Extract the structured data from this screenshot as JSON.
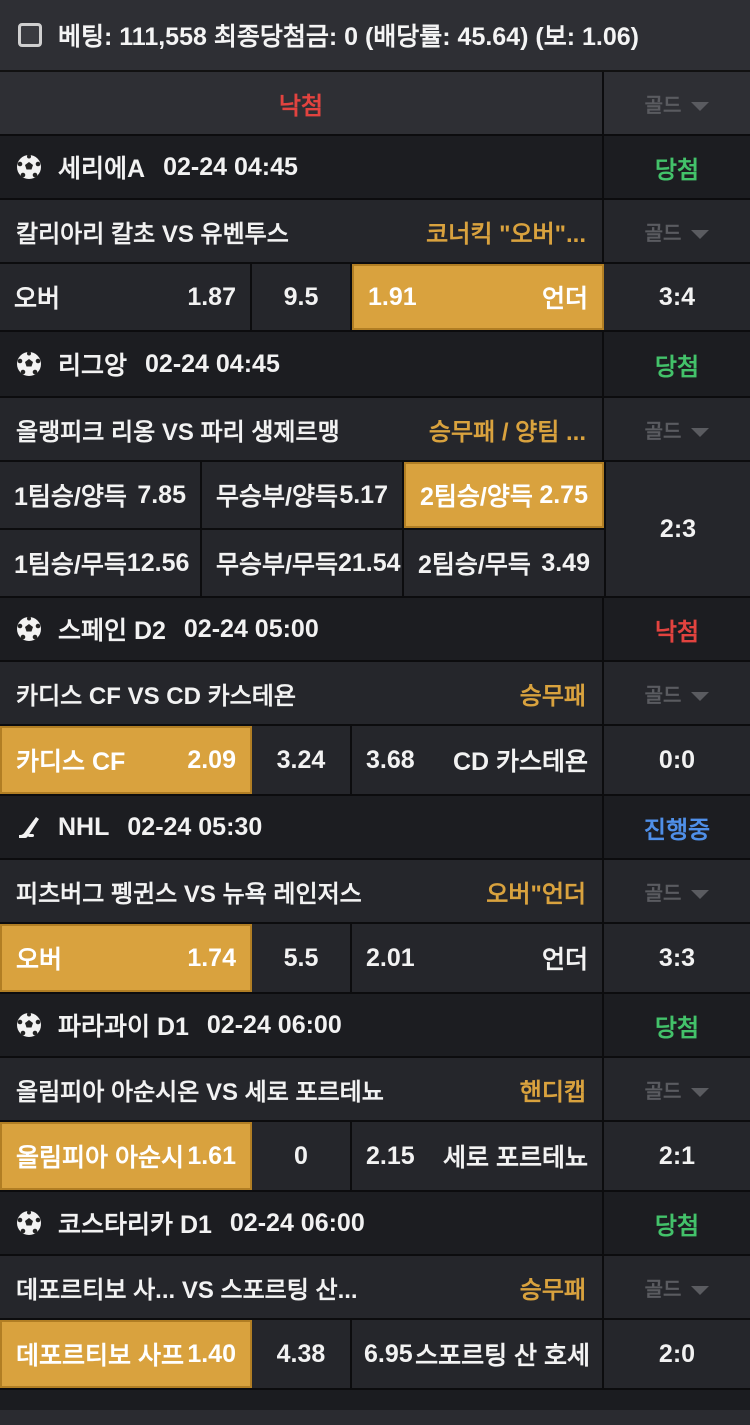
{
  "header": {
    "text": "베팅: 111,558 최종당첨금: 0 (배당률: 45.64) (보: 1.06)"
  },
  "top": {
    "result": "낙첨",
    "gold_label": "골드"
  },
  "colors": {
    "accent": "#d9a23e",
    "win": "#43c26a",
    "lose": "#e2433f",
    "progress": "#4f8fe8"
  },
  "games": [
    {
      "icon": "soccer-ball-icon",
      "league": "세리에A",
      "time": "02-24 04:45",
      "status": "당첨",
      "teams": "칼리아리 칼초 VS 유벤투스",
      "bet_type": "코너킥 \"오버\"...",
      "gold_label": "골드",
      "odds": {
        "left_label": "오버",
        "left_odd": "1.87",
        "mid": "9.5",
        "right_odd": "1.91",
        "right_label": "언더"
      },
      "score": "3:4"
    },
    {
      "icon": "soccer-ball-icon",
      "league": "리그앙",
      "time": "02-24 04:45",
      "status": "당첨",
      "teams": "올랭피크 리옹 VS 파리 생제르맹",
      "bet_type": "승무패 / 양팀 ...",
      "gold_label": "골드",
      "grid": [
        [
          "1팀승/양득",
          "7.85",
          "무승부/양득",
          "5.17",
          "2팀승/양득",
          "2.75"
        ],
        [
          "1팀승/무득",
          "12.56",
          "무승부/무득",
          "21.54",
          "2팀승/무득",
          "3.49"
        ]
      ],
      "score": "2:3"
    },
    {
      "icon": "soccer-ball-icon",
      "league": "스페인 D2",
      "time": "02-24 05:00",
      "status": "낙첨",
      "teams": "카디스 CF VS CD 카스테욘",
      "bet_type": "승무패",
      "gold_label": "골드",
      "odds": {
        "left_label": "카디스 CF",
        "left_odd": "2.09",
        "mid": "3.24",
        "right_odd": "3.68",
        "right_label": "CD 카스테욘"
      },
      "score": "0:0"
    },
    {
      "icon": "hockey-stick-icon",
      "league": "NHL",
      "time": "02-24 05:30",
      "status": "진행중",
      "teams": "피츠버그 펭귄스 VS 뉴욕 레인저스",
      "bet_type": "오버\"언더",
      "gold_label": "골드",
      "odds": {
        "left_label": "오버",
        "left_odd": "1.74",
        "mid": "5.5",
        "right_odd": "2.01",
        "right_label": "언더"
      },
      "score": "3:3"
    },
    {
      "icon": "soccer-ball-icon",
      "league": "파라과이 D1",
      "time": "02-24 06:00",
      "status": "당첨",
      "teams": "올림피아 아순시온 VS 세로 포르테뇨",
      "bet_type": "핸디캡",
      "gold_label": "골드",
      "odds": {
        "left_label": "올림피아 아순시",
        "left_odd": "1.61",
        "mid": "0",
        "right_odd": "2.15",
        "right_label": "세로 포르테뇨"
      },
      "score": "2:1"
    },
    {
      "icon": "soccer-ball-icon",
      "league": "코스타리카 D1",
      "time": "02-24 06:00",
      "status": "당첨",
      "teams": "데포르티보 사...  VS 스포르팅 산...",
      "bet_type": "승무패",
      "gold_label": "골드",
      "odds": {
        "left_label": "데포르티보 사프",
        "left_odd": "1.40",
        "mid": "4.38",
        "right_odd": "6.95",
        "right_label": "스포르팅 산 호세"
      },
      "score": "2:0"
    }
  ]
}
